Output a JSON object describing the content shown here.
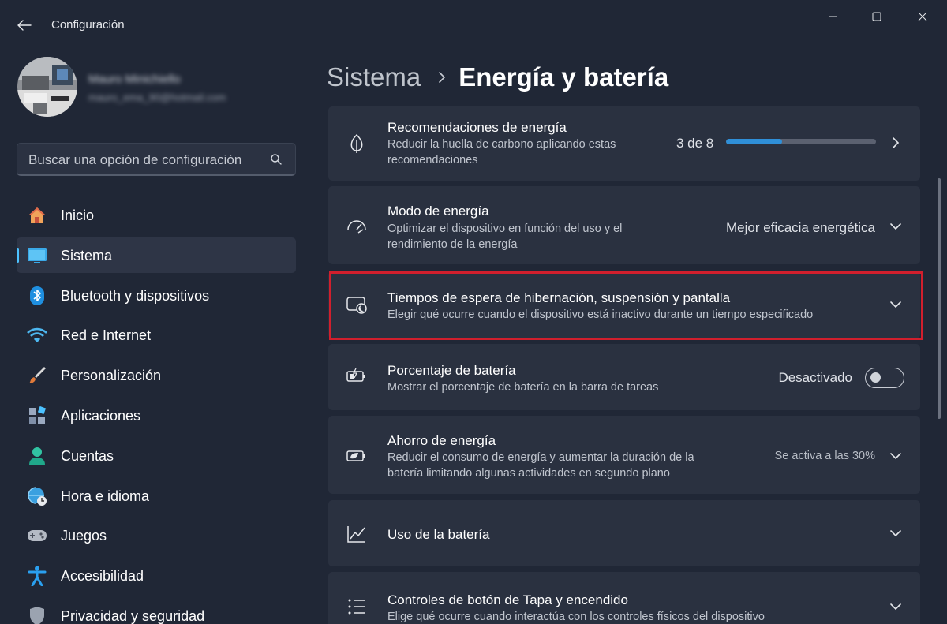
{
  "window": {
    "title": "Configuración",
    "controls": [
      "minimize-icon",
      "maximize-icon",
      "close-icon"
    ]
  },
  "profile": {
    "name": "Mauro Minichiello",
    "email": "mauro_ema_90@hotmail.com"
  },
  "search": {
    "placeholder": "Buscar una opción de configuración"
  },
  "sidebar": {
    "items": [
      {
        "label": "Inicio",
        "icon": "home-icon",
        "active": false
      },
      {
        "label": "Sistema",
        "icon": "monitor-icon",
        "active": true
      },
      {
        "label": "Bluetooth y dispositivos",
        "icon": "bluetooth-icon",
        "active": false
      },
      {
        "label": "Red e Internet",
        "icon": "wifi-icon",
        "active": false
      },
      {
        "label": "Personalización",
        "icon": "brush-icon",
        "active": false
      },
      {
        "label": "Aplicaciones",
        "icon": "apps-icon",
        "active": false
      },
      {
        "label": "Cuentas",
        "icon": "person-icon",
        "active": false
      },
      {
        "label": "Hora e idioma",
        "icon": "clock-globe-icon",
        "active": false
      },
      {
        "label": "Juegos",
        "icon": "gamepad-icon",
        "active": false
      },
      {
        "label": "Accesibilidad",
        "icon": "accessibility-icon",
        "active": false
      },
      {
        "label": "Privacidad y seguridad",
        "icon": "shield-icon",
        "active": false
      }
    ]
  },
  "breadcrumb": {
    "parent": "Sistema",
    "current": "Energía y batería"
  },
  "cards": {
    "recommendations": {
      "title": "Recomendaciones de energía",
      "desc": "Reducir la huella de carbono aplicando estas recomendaciones",
      "count_text": "3 de 8",
      "progress_fraction": 0.375
    },
    "power_mode": {
      "title": "Modo de energía",
      "desc": "Optimizar el dispositivo en función del uso y el rendimiento de la energía",
      "value": "Mejor eficacia energética"
    },
    "timeouts": {
      "title": "Tiempos de espera de hibernación, suspensión y pantalla",
      "desc": "Elegir qué ocurre cuando el dispositivo está inactivo durante un tiempo especificado"
    },
    "battery_percentage": {
      "title": "Porcentaje de batería",
      "desc": "Mostrar el porcentaje de batería en la barra de tareas",
      "state": "Desactivado",
      "on": false
    },
    "energy_saver": {
      "title": "Ahorro de energía",
      "desc": "Reducir el consumo de energía y aumentar la duración de la batería limitando algunas actividades en segundo plano",
      "value": "Se activa a las 30%"
    },
    "battery_usage": {
      "title": "Uso de la batería"
    },
    "lid_power": {
      "title": "Controles de botón de Tapa y encendido",
      "desc": "Elige qué ocurre cuando interactúa con los controles físicos del dispositivo"
    }
  },
  "colors": {
    "background": "#202736",
    "card": "#2a3140",
    "accent": "#4cc2ff",
    "progress": "#2f8fd8",
    "highlight": "#d11f2d"
  }
}
